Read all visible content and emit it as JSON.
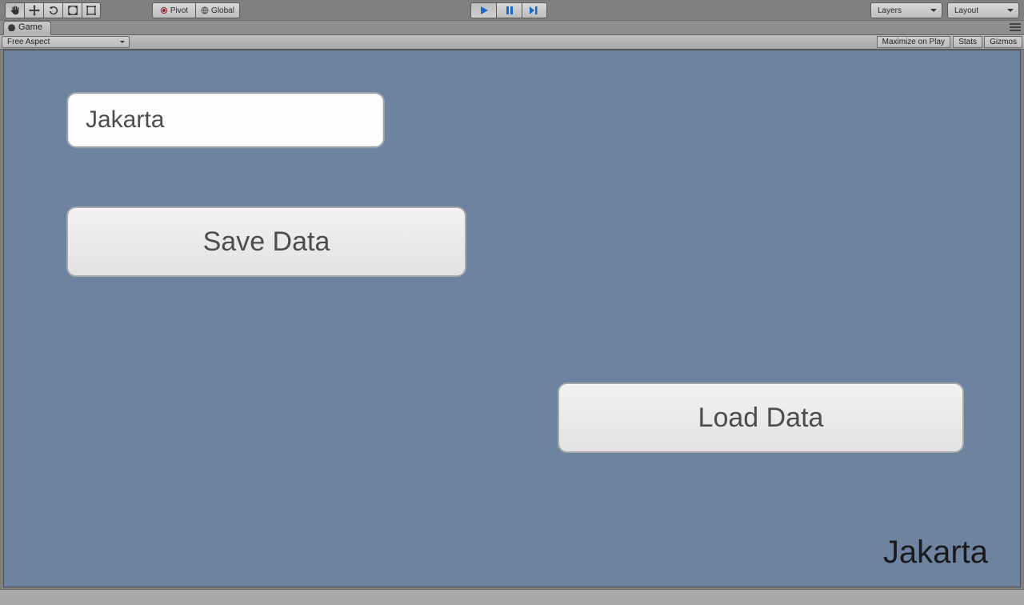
{
  "toolbar": {
    "pivot_label": "Pivot",
    "global_label": "Global",
    "layers_label": "Layers",
    "layout_label": "Layout"
  },
  "tabs": {
    "game": "Game"
  },
  "ctrl": {
    "aspect": "Free Aspect",
    "maximize": "Maximize on Play",
    "stats": "Stats",
    "gizmos": "Gizmos"
  },
  "game_ui": {
    "input_value": "Jakarta",
    "save_label": "Save Data",
    "load_label": "Load Data",
    "output_text": "Jakarta"
  }
}
